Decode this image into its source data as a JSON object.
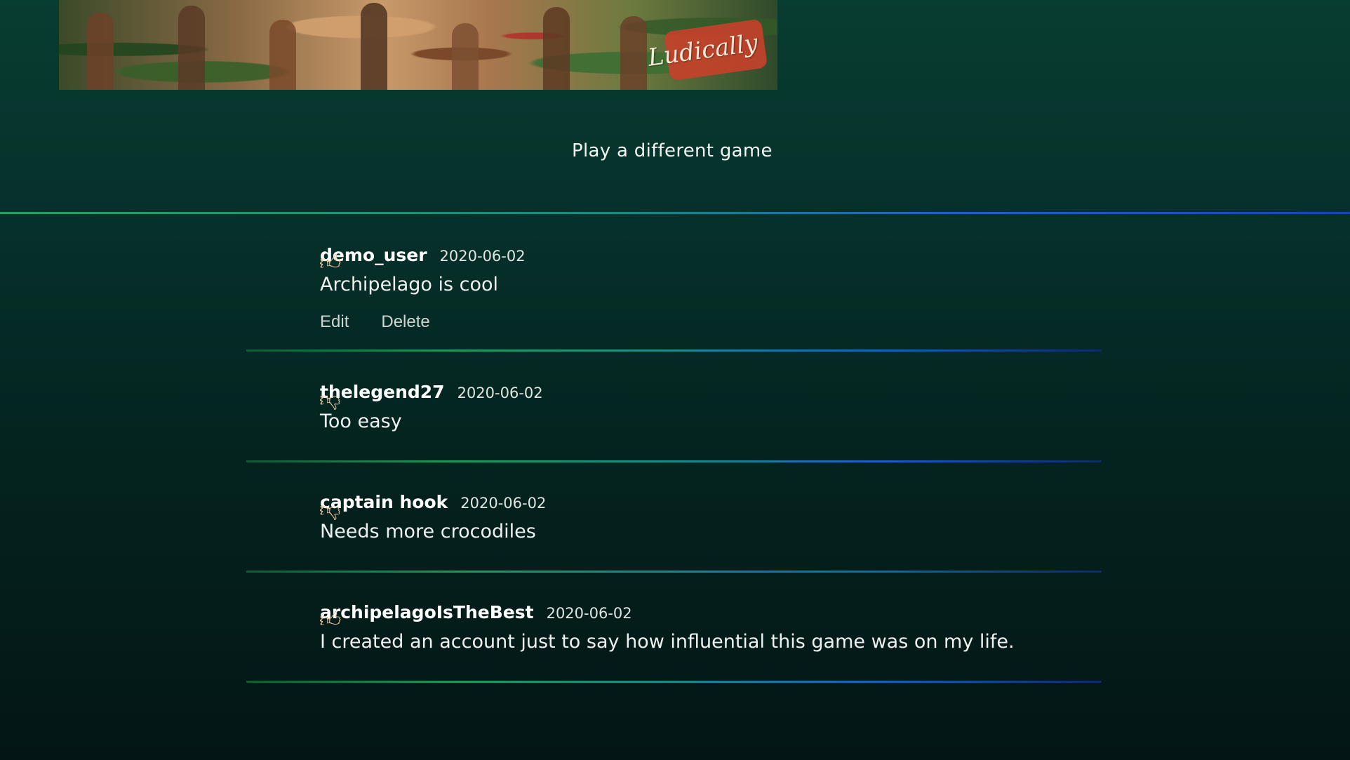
{
  "banner": {
    "logo_text": "Ludically"
  },
  "play_link": "Play a different game",
  "comments": [
    {
      "username": "demo_user",
      "date": "2020-06-02",
      "text": "Archipelago is cool",
      "rating_icon": "thumbs-up-icon",
      "actions": {
        "edit": "Edit",
        "delete": "Delete"
      }
    },
    {
      "username": "thelegend27",
      "date": "2020-06-02",
      "text": "Too easy",
      "rating_icon": "thumbs-down-icon"
    },
    {
      "username": "captain hook",
      "date": "2020-06-02",
      "text": "Needs more crocodiles",
      "rating_icon": "thumbs-down-icon"
    },
    {
      "username": "archipelagoIsTheBest",
      "date": "2020-06-02",
      "text": "I created an account just to say how influential this game was on my life.",
      "rating_icon": "thumbs-up-icon"
    }
  ],
  "colors": {
    "background_top": "#083d31",
    "background_bottom": "#031615",
    "divider_green": "#1fa55a",
    "divider_blue": "#1445b8",
    "thumb": "#e7c39b"
  }
}
